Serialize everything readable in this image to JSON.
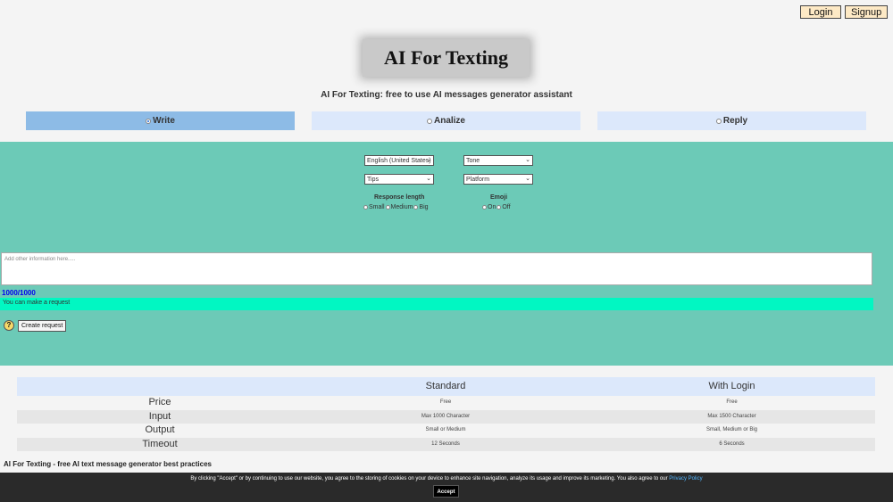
{
  "header": {
    "login_label": "Login",
    "signup_label": "Signup",
    "logo_text": "AI For Texting",
    "subtitle": "AI For Texting: free to use AI messages generator assistant"
  },
  "modes": [
    {
      "label": "Write",
      "selected": true
    },
    {
      "label": "Analize",
      "selected": false
    },
    {
      "label": "Reply",
      "selected": false
    }
  ],
  "options": {
    "language": "English (United States)",
    "tone": "Tone",
    "tips": "Tips",
    "platform": "Platform",
    "response_length": {
      "label": "Response length",
      "choices": [
        "Small",
        "Medium",
        "Big"
      ]
    },
    "emoji": {
      "label": "Emoji",
      "choices": [
        "On",
        "Off"
      ]
    }
  },
  "input": {
    "placeholder": "Add other information here.....",
    "counter": "1000/1000",
    "status": "You can make a request",
    "help": "?",
    "create_label": "Create request"
  },
  "pricing_table": {
    "headers": [
      "",
      "Standard",
      "With Login"
    ],
    "rows": [
      [
        "Price",
        "Free",
        "Free"
      ],
      [
        "Input",
        "Max 1000 Character",
        "Max 1500 Character"
      ],
      [
        "Output",
        "Small or Medium",
        "Small, Medium or Big"
      ],
      [
        "Timeout",
        "12 Seconds",
        "6 Seconds"
      ]
    ]
  },
  "best_practices_title": "AI For Texting - free AI text message generator best practices",
  "cookie": {
    "message": "By clicking \"Accept\" or by continuing to use our website, you agree to the storing of cookies on your device to enhance site navigation, analyze its usage and improve its marketing. You also agree to our",
    "link": "Privacy Policy",
    "accept_label": "Accept"
  },
  "colors": {
    "panel": "#6ccab7",
    "status": "#01f7c2",
    "tab_active": "#8dbbe6",
    "tab": "#dce8fb",
    "auth_button": "#fde9c5"
  }
}
